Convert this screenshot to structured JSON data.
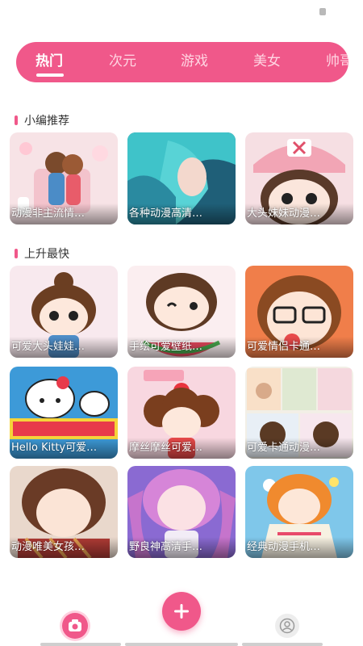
{
  "tabs": [
    {
      "label": "热门",
      "active": true
    },
    {
      "label": "次元",
      "active": false
    },
    {
      "label": "游戏",
      "active": false
    },
    {
      "label": "美女",
      "active": false
    },
    {
      "label": "帅哥",
      "active": false
    }
  ],
  "sections": {
    "recommend": {
      "title": "小编推荐",
      "items": [
        {
          "caption": "动漫非主流情…",
          "icon": "couple-hug-image"
        },
        {
          "caption": "各种动漫高清…",
          "icon": "anime-girl-blue-hair-image"
        },
        {
          "caption": "大头妹妹动漫…",
          "icon": "chibi-girl-pink-hat-image"
        }
      ]
    },
    "rising": {
      "title": "上升最快",
      "items": [
        {
          "caption": "可爱大头娃娃…",
          "icon": "chibi-girl-bun-image"
        },
        {
          "caption": "手绘可爱壁纸…",
          "icon": "chibi-girl-watermelon-image"
        },
        {
          "caption": "可爱情侣卡通…",
          "icon": "cartoon-glasses-girl-image"
        },
        {
          "caption": "Hello Kitty可爱…",
          "icon": "hello-kitty-image"
        },
        {
          "caption": "摩丝摩丝可爱…",
          "icon": "moe-curly-hair-girl-image"
        },
        {
          "caption": "可爱卡通动漫…",
          "icon": "cartoon-grid-collage-image"
        },
        {
          "caption": "动漫唯美女孩…",
          "icon": "anime-girl-scarf-image"
        },
        {
          "caption": "野良神高清手…",
          "icon": "anime-girl-purple-hair-image"
        },
        {
          "caption": "经典动漫手机…",
          "icon": "anime-girl-orange-hair-image"
        }
      ]
    }
  },
  "colors": {
    "accent": "#f0588a",
    "tab_inactive": "#ffd6e3"
  },
  "bottom_nav": {
    "home_icon": "camera-home-icon",
    "add_icon": "plus-icon",
    "profile_icon": "user-profile-icon"
  }
}
